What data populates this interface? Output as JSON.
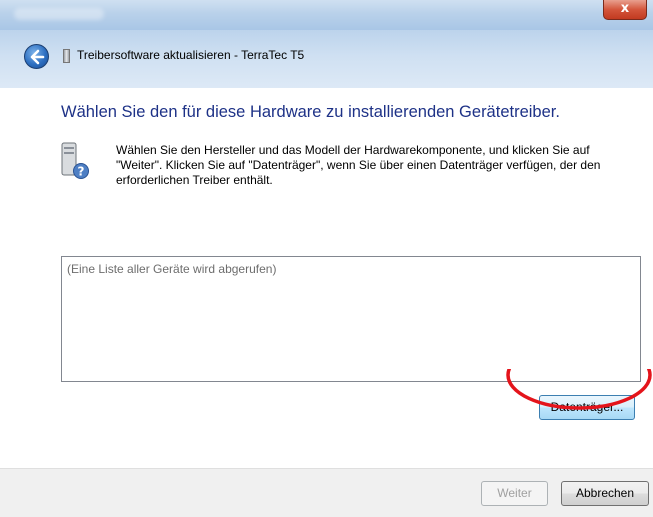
{
  "window": {
    "close_label": "x"
  },
  "header": {
    "back_icon": "back-arrow-icon",
    "device_icon": "device-icon",
    "title": "Treibersoftware aktualisieren - TerraTec T5"
  },
  "main": {
    "heading": "Wählen Sie den für diese Hardware zu installierenden Gerätetreiber.",
    "hardware_icon": "hardware-help-icon",
    "description": "Wählen Sie den Hersteller und das Modell der Hardwarekomponente, und klicken Sie auf \"Weiter\". Klicken Sie auf \"Datenträger\", wenn Sie über einen Datenträger verfügen, der den erforderlichen Treiber enthält.",
    "list_placeholder": "(Eine Liste aller Geräte wird abgerufen)",
    "disk_button": "Datenträger..."
  },
  "footer": {
    "next_button": "Weiter",
    "cancel_button": "Abbrechen"
  },
  "colors": {
    "heading": "#1e3287",
    "annotation_ellipse": "#e4141b"
  }
}
